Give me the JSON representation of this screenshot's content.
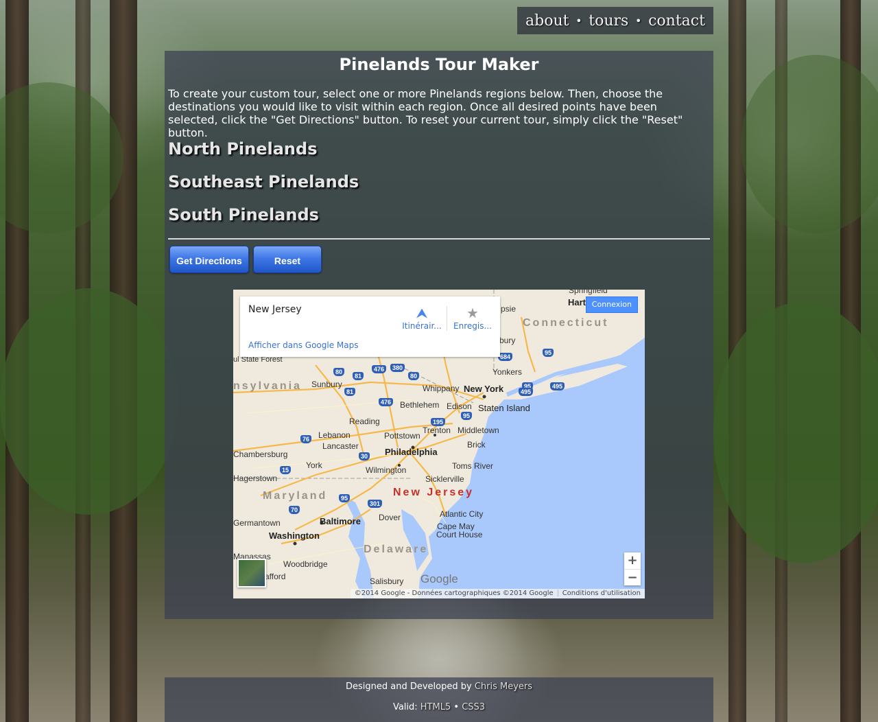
{
  "nav": {
    "about": "about",
    "tours": "tours",
    "contact": "contact",
    "separator": "•"
  },
  "page": {
    "title": "Pinelands Tour Maker",
    "intro": "To create your custom tour, select one or more Pinelands regions below. Then, choose the destinations you would like to visit within each region. Once all desired points have been selected, click the \"Get Directions\" button. To reset your current tour, simply click the \"Reset\" button."
  },
  "regions": [
    "North Pinelands",
    "Southeast Pinelands",
    "South Pinelands"
  ],
  "buttons": {
    "get_directions": "Get Directions",
    "reset": "Reset"
  },
  "map": {
    "place_name": "New Jersey",
    "directions_label": "Itinérair...",
    "save_label": "Enregis...",
    "view_in_maps": "Afficher dans Google Maps",
    "sign_in": "Connexion",
    "zoom_in": "+",
    "zoom_out": "−",
    "logo": "Google",
    "attribution": "©2014 Google - Données cartographiques ©2014 Google",
    "terms": "Conditions d'utilisation",
    "labels": {
      "connecticut": "Connecticut",
      "pennsylvania": "nsylvania",
      "maryland": "Maryland",
      "new_jersey": "New Jersey",
      "delaware": "Delaware",
      "hartford": "Hartford",
      "springfield": "Springfield",
      "psie": "psie",
      "bury": "bury",
      "state_forest": "ul State Forest",
      "yonkers": "Yonkers",
      "new_york": "New York",
      "sunbury": "Sunbury",
      "whippany": "Whippany",
      "bethlehem": "Bethlehem",
      "edison": "Edison",
      "staten_island": "Staten Island",
      "reading": "Reading",
      "trenton": "Trenton",
      "middletown": "Middletown",
      "lebanon": "Lebanon",
      "pottstown": "Pottstown",
      "lancaster": "Lancaster",
      "philadelphia": "Philadelphia",
      "brick": "Brick",
      "chambersburg": "Chambersburg",
      "york": "York",
      "toms_river": "Toms River",
      "wilmington": "Wilmington",
      "hagerstown": "Hagerstown",
      "sicklerville": "Sicklerville",
      "baltimore": "Baltimore",
      "atlantic_city": "Atlantic City",
      "dover": "Dover",
      "germantown": "Germantown",
      "cape_may": "Cape May",
      "cape_may_court_house": "Court House",
      "washington": "Washington",
      "manassas": "Manassas",
      "woodbridge": "Woodbridge",
      "stafford": "afford",
      "salisbury": "Salisbury"
    },
    "shields": [
      "84",
      "95",
      "80",
      "81",
      "476",
      "380",
      "80",
      "81",
      "476",
      "95",
      "495",
      "495",
      "95",
      "76",
      "30",
      "15",
      "95",
      "70",
      "301",
      "195",
      "684"
    ]
  },
  "footer": {
    "credit_prefix": "Designed and Developed by",
    "author": "Chris Meyers",
    "valid_prefix": "Valid:",
    "html5": "HTML5",
    "bullet": "•",
    "css3": "CSS3"
  },
  "colors": {
    "panel": "#3a4052",
    "button": "#3f78e6",
    "map_water": "#a9c8fb",
    "map_land": "#efeadd",
    "nj_label": "#c4302b"
  }
}
